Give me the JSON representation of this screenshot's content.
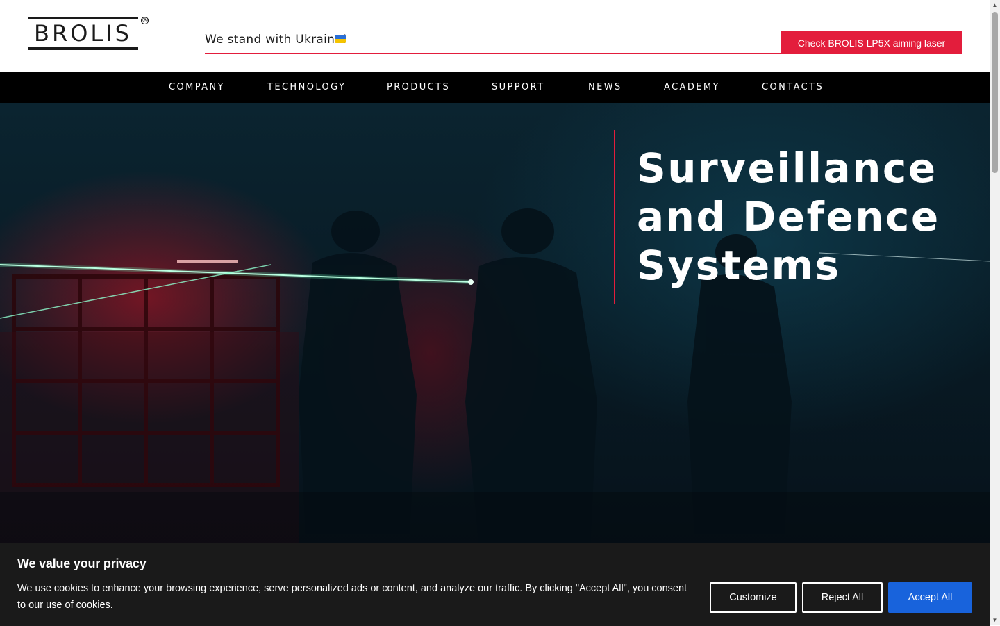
{
  "header": {
    "logo_text": "BROLIS",
    "logo_mark": "®",
    "banner_text": "We stand with Ukraine!",
    "flag_icon": "ukraine-flag-icon",
    "cta_label": "Check BROLIS LP5X aiming laser"
  },
  "nav": {
    "items": [
      {
        "label": "COMPANY"
      },
      {
        "label": "TECHNOLOGY"
      },
      {
        "label": "PRODUCTS"
      },
      {
        "label": "SUPPORT"
      },
      {
        "label": "NEWS"
      },
      {
        "label": "ACADEMY"
      },
      {
        "label": "CONTACTS"
      }
    ]
  },
  "hero": {
    "title_line1": "Surveillance",
    "title_line2": "and Defence",
    "title_line3": "Systems"
  },
  "cookie": {
    "title": "We value your privacy",
    "body": "We use cookies to enhance your browsing experience, serve personalized ads or content, and analyze our traffic. By clicking \"Accept All\", you consent to our use of cookies.",
    "customize_label": "Customize",
    "reject_label": "Reject All",
    "accept_label": "Accept All"
  },
  "colors": {
    "accent_red": "#e31d3c",
    "accept_blue": "#1863dc",
    "nav_bg": "#000000",
    "banner_bg": "#1a1a1a"
  }
}
